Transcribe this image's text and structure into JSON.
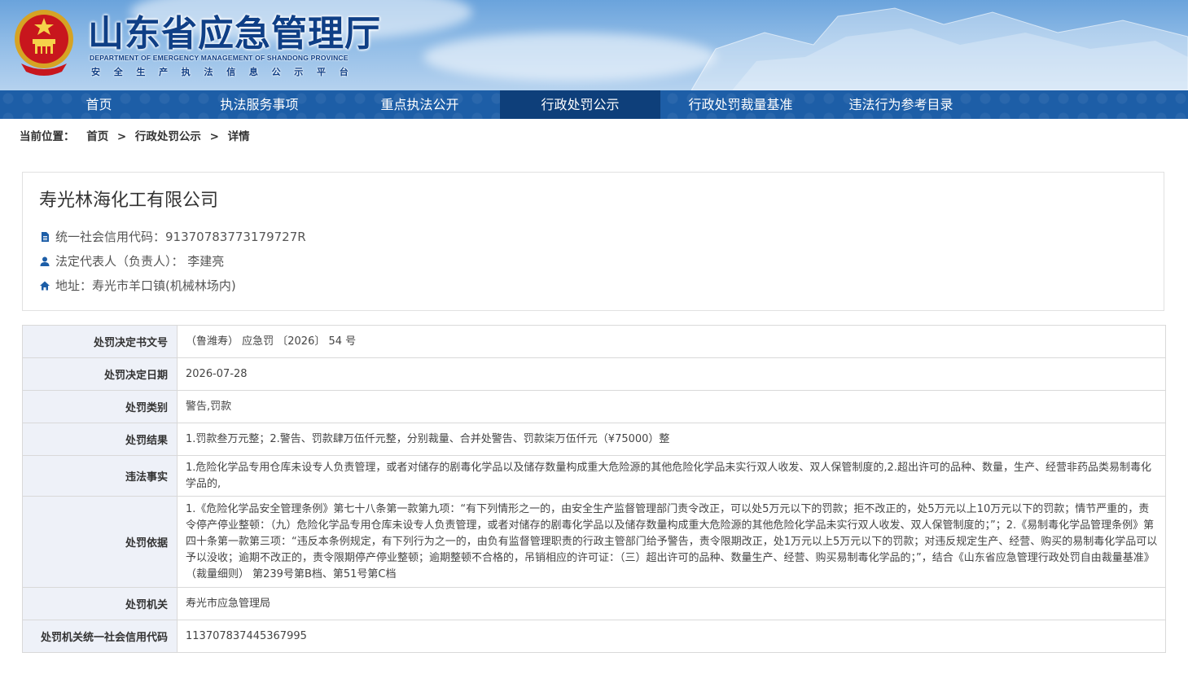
{
  "header": {
    "title": "山东省应急管理厅",
    "subtitle_en": "DEPARTMENT OF EMERGENCY MANAGEMENT OF SHANDONG PROVINCE",
    "tagline": "安全生产执法信息公示平台",
    "emblem_icon": "national-emblem-icon"
  },
  "nav": {
    "items": [
      {
        "label": "首页",
        "active": false
      },
      {
        "label": "执法服务事项",
        "active": false
      },
      {
        "label": "重点执法公开",
        "active": false
      },
      {
        "label": "行政处罚公示",
        "active": true
      },
      {
        "label": "行政处罚裁量基准",
        "active": false
      },
      {
        "label": "违法行为参考目录",
        "active": false
      }
    ],
    "active_color": "#0e3f7a",
    "bar_color": "#1d5ea7"
  },
  "breadcrumb": {
    "prefix": "当前位置：",
    "items": [
      "首页",
      "行政处罚公示",
      "详情"
    ],
    "separator": ">"
  },
  "company": {
    "name": "寿光林海化工有限公司",
    "credit_code": "统一社会信用代码：91370783773179727R",
    "legal_rep": "法定代表人（负责人）： 李建亮",
    "address": "地址：寿光市羊口镇(机械林场内)",
    "icons": [
      "document-icon",
      "user-icon",
      "home-icon"
    ]
  },
  "details": {
    "rows": [
      {
        "label": "处罚决定书文号",
        "value": "（鲁潍寿） 应急罚 〔2026〕 54 号"
      },
      {
        "label": "处罚决定日期",
        "value": "2026-07-28"
      },
      {
        "label": "处罚类别",
        "value": "警告,罚款"
      },
      {
        "label": "处罚结果",
        "value": "1.罚款叁万元整；2.警告、罚款肆万伍仟元整，分别裁量、合并处警告、罚款柒万伍仟元（¥75000）整"
      },
      {
        "label": "违法事实",
        "value": "1.危险化学品专用仓库未设专人负责管理，或者对储存的剧毒化学品以及储存数量构成重大危险源的其他危险化学品未实行双人收发、双人保管制度的,2.超出许可的品种、数量，生产、经营非药品类易制毒化学品的,"
      },
      {
        "label": "处罚依据",
        "value": "1.《危险化学品安全管理条例》第七十八条第一款第九项：“有下列情形之一的，由安全生产监督管理部门责令改正，可以处5万元以下的罚款；拒不改正的，处5万元以上10万元以下的罚款；情节严重的，责令停产停业整顿：（九）危险化学品专用仓库未设专人负责管理，或者对储存的剧毒化学品以及储存数量构成重大危险源的其他危险化学品未实行双人收发、双人保管制度的；”；2.《易制毒化学品管理条例》第四十条第一款第三项：“违反本条例规定，有下列行为之一的，由负有监督管理职责的行政主管部门给予警告，责令限期改正，处1万元以上5万元以下的罚款；对违反规定生产、经营、购买的易制毒化学品可以予以没收；逾期不改正的，责令限期停产停业整顿；逾期整顿不合格的，吊销相应的许可证：（三）超出许可的品种、数量生产、经营、购买易制毒化学品的；”，结合《山东省应急管理行政处罚自由裁量基准》（裁量细则） 第239号第B档、第51号第C档"
      },
      {
        "label": "处罚机关",
        "value": "寿光市应急管理局"
      },
      {
        "label": "处罚机关统一社会信用代码",
        "value": "113707837445367995"
      }
    ]
  }
}
